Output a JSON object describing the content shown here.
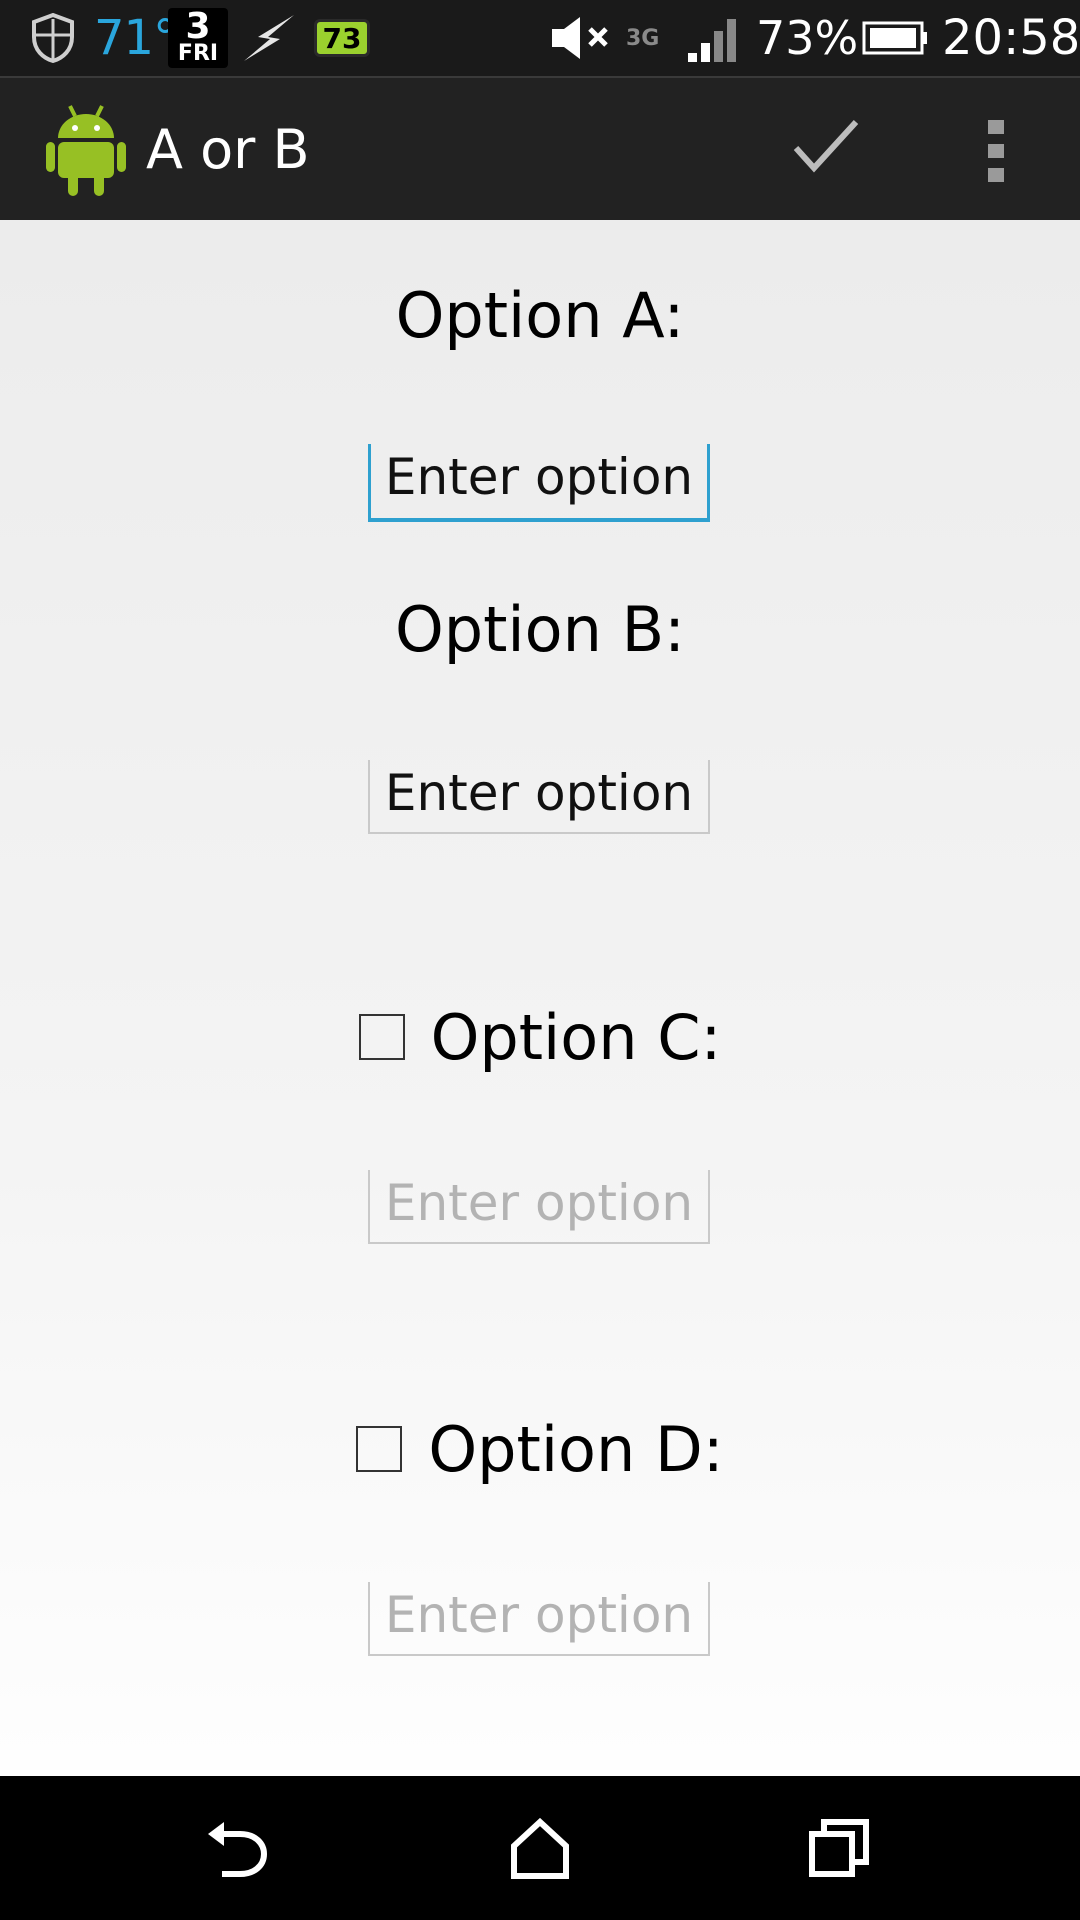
{
  "status_bar": {
    "temperature": "71°",
    "date_day": "3",
    "date_weekday": "FRI",
    "battery_badge": "73",
    "network_type": "3G",
    "battery_percent": "73%",
    "time": "20:58",
    "icons": [
      "shield-icon",
      "lightning-icon",
      "mute-icon",
      "signal-icon",
      "battery-icon"
    ]
  },
  "action_bar": {
    "title": "A or B",
    "icons": [
      "android-logo-icon",
      "check-icon",
      "overflow-menu-icon"
    ]
  },
  "form": {
    "option_a": {
      "label": "Option A:",
      "value": "Enter option",
      "state": "focused"
    },
    "option_b": {
      "label": "Option B:",
      "value": "Enter option",
      "state": "idle"
    },
    "option_c": {
      "label": "Option C:",
      "checked": false,
      "placeholder": "Enter option"
    },
    "option_d": {
      "label": "Option D:",
      "checked": false,
      "placeholder": "Enter option"
    }
  },
  "nav_bar": {
    "icons": [
      "back-icon",
      "home-icon",
      "recent-apps-icon"
    ]
  },
  "colors": {
    "accent": "#2ea0cf",
    "temp_color": "#2aa6dd",
    "battery_badge": "#9bd12e",
    "android_green": "#97c024"
  }
}
